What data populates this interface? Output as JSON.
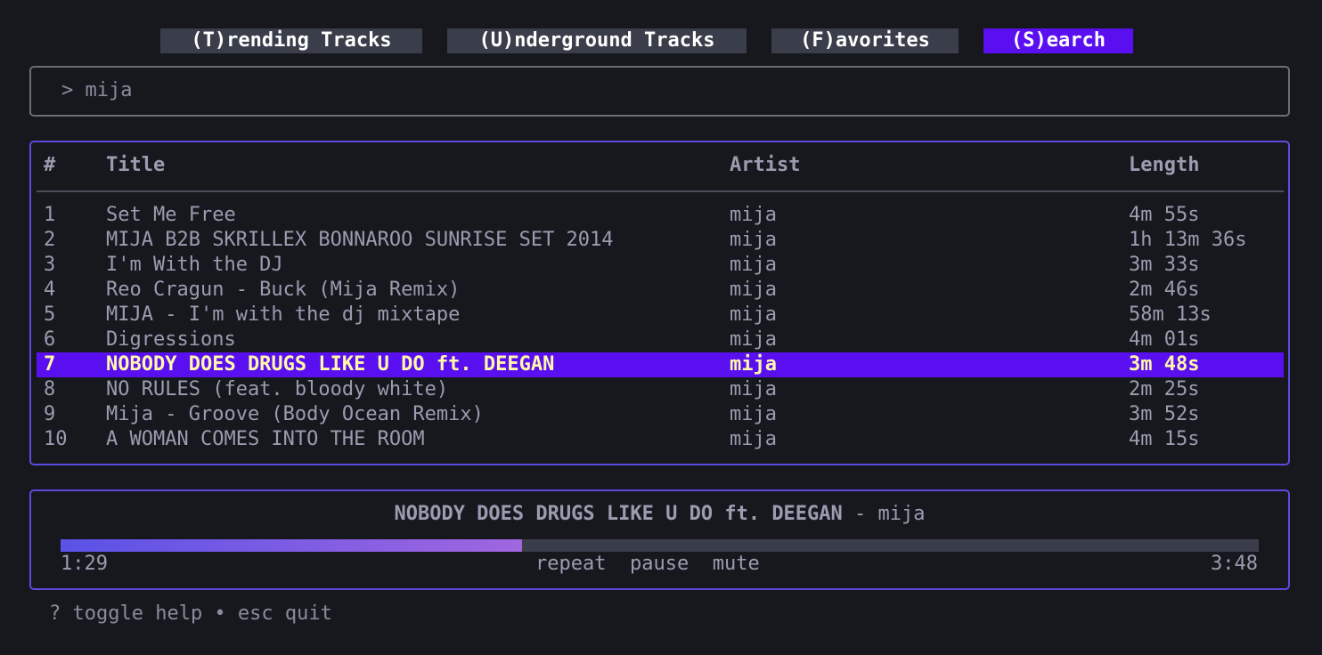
{
  "tabs": [
    {
      "label": " (T)rending Tracks ",
      "active": false
    },
    {
      "label": " (U)nderground Tracks ",
      "active": false
    },
    {
      "label": " (F)avorites ",
      "active": false
    },
    {
      "label": " (S)earch ",
      "active": true
    }
  ],
  "search": {
    "prompt": "> ",
    "value": "mija"
  },
  "table": {
    "headers": {
      "num": "#",
      "title": "Title",
      "artist": "Artist",
      "length": "Length"
    },
    "rows": [
      {
        "num": "1",
        "title": "Set Me Free",
        "artist": "mija",
        "length": "4m 55s"
      },
      {
        "num": "2",
        "title": "MIJA B2B SKRILLEX BONNAROO SUNRISE SET 2014",
        "artist": "mija",
        "length": "1h 13m 36s"
      },
      {
        "num": "3",
        "title": "I'm With the DJ",
        "artist": "mija",
        "length": "3m 33s"
      },
      {
        "num": "4",
        "title": "Reo Cragun - Buck (Mija Remix)",
        "artist": "mija",
        "length": "2m 46s"
      },
      {
        "num": "5",
        "title": "MIJA - I'm with the dj mixtape",
        "artist": "mija",
        "length": "58m 13s"
      },
      {
        "num": "6",
        "title": "Digressions",
        "artist": "mija",
        "length": "4m 01s"
      },
      {
        "num": "7",
        "title": "NOBODY DOES DRUGS LIKE U DO ft. DEEGAN",
        "artist": "mija",
        "length": "3m 48s"
      },
      {
        "num": "8",
        "title": "NO RULES (feat. bloody white)",
        "artist": "mija",
        "length": "2m 25s"
      },
      {
        "num": "9",
        "title": "Mija - Groove (Body Ocean Remix)",
        "artist": "mija",
        "length": "3m 52s"
      },
      {
        "num": "10",
        "title": "A WOMAN COMES INTO THE ROOM",
        "artist": "mija",
        "length": "4m 15s"
      }
    ],
    "selected_row": 7
  },
  "player": {
    "track_title": "NOBODY DOES DRUGS LIKE U DO ft. DEEGAN",
    "separator": " - ",
    "track_artist": "mija",
    "elapsed": "1:29",
    "total": "3:48",
    "progress_fraction": 0.385,
    "controls": {
      "repeat": "repeat",
      "pause": "pause",
      "mute": "mute"
    }
  },
  "help": "? toggle help • esc quit",
  "colors": {
    "accent": "#5a0ff0",
    "border_accent": "#5a4be0",
    "selected_text": "#fff8a8",
    "background": "#17181e"
  }
}
